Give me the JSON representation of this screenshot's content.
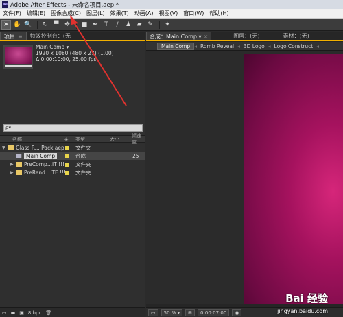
{
  "window": {
    "title": "Adobe After Effects - 未命名项目.aep *",
    "logo_text": "Ae"
  },
  "menu": [
    "文件(F)",
    "编辑(E)",
    "图像合成(C)",
    "图层(L)",
    "效果(T)",
    "动画(A)",
    "视图(V)",
    "窗口(W)",
    "帮助(H)"
  ],
  "toolbar": {
    "tools": [
      {
        "name": "selection-tool-icon",
        "glyph": "➤",
        "selected": true
      },
      {
        "name": "hand-tool-icon",
        "glyph": "✋"
      },
      {
        "name": "zoom-tool-icon",
        "glyph": "🔍"
      },
      {
        "name": "rotate-tool-icon",
        "glyph": "↻"
      },
      {
        "name": "camera-tool-icon",
        "glyph": "▀"
      },
      {
        "name": "pan-behind-tool-icon",
        "glyph": "✥"
      },
      {
        "name": "rectangle-tool-icon",
        "glyph": "■"
      },
      {
        "name": "pen-tool-icon",
        "glyph": "✒"
      },
      {
        "name": "type-tool-icon",
        "glyph": "T"
      },
      {
        "name": "brush-tool-icon",
        "glyph": "∕"
      },
      {
        "name": "clone-stamp-tool-icon",
        "glyph": "♟"
      },
      {
        "name": "eraser-tool-icon",
        "glyph": "▰"
      },
      {
        "name": "roto-brush-tool-icon",
        "glyph": "✎"
      },
      {
        "name": "puppet-pin-tool-icon",
        "glyph": "✦"
      }
    ]
  },
  "project_panel": {
    "tab_label": "项目",
    "tab_close": "≡",
    "effects_tab_label": "特效控制台：(无",
    "comp_name": "Main Comp ▾",
    "comp_dims": "1920 x 1080  (480 x 27)  (1.00)",
    "comp_duration": "Δ 0:00:10:00, 25.00 fps",
    "search_placeholder": "ρ▾",
    "columns": {
      "name": "名称",
      "label": "◈",
      "type": "类型",
      "size": "大小",
      "rate": "帧速率"
    },
    "rows": [
      {
        "name": "Glass R... Pack.aep",
        "type": "文件夹",
        "size": "",
        "expanded": true,
        "indent": 0,
        "kind": "folder",
        "selected": false
      },
      {
        "name": "Main Comp",
        "type": "合成",
        "size": "25",
        "expanded": false,
        "indent": 1,
        "kind": "comp",
        "selected": true
      },
      {
        "name": "PreComp...IT !!!",
        "type": "文件夹",
        "size": "",
        "expanded": false,
        "indent": 1,
        "kind": "folder",
        "selected": false
      },
      {
        "name": "PreRend....TE !!!",
        "type": "文件夹",
        "size": "",
        "expanded": false,
        "indent": 1,
        "kind": "folder",
        "selected": false
      }
    ],
    "footer_bpc": "8 bpc"
  },
  "comp_panel": {
    "tabs": [
      "合成：Main Comp ▾",
      "图层：(无)",
      "素材：(无)"
    ],
    "comp_tabs": [
      "Main Comp",
      "Romb Reveal",
      "3D Logo",
      "Logo Construct"
    ],
    "zoom": "50 %",
    "timecode": "0:00:07:00"
  },
  "watermark": {
    "brand": "Bai 经验",
    "url": "jingyan.baidu.com"
  },
  "colors": {
    "accent": "#f1b000",
    "annotation_arrow": "#e0322f",
    "comp_bg": "#a5125e"
  }
}
